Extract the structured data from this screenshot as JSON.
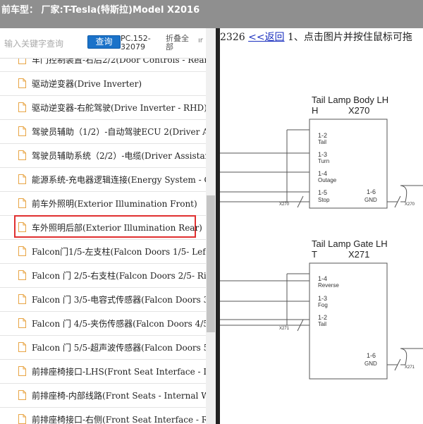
{
  "header": {
    "title": "前车型：  厂家:T-Tesla(特斯拉)Model X2016"
  },
  "search": {
    "placeholder": "输入关键字查询",
    "button": "查询",
    "code": "PC.152-32079",
    "collapse": "折叠全部",
    "extra": "ır"
  },
  "tree": {
    "items": [
      {
        "label": "车门控制装置-右后2/2(Door Controls - Rear R"
      },
      {
        "label": "驱动逆变器(Drive Inverter)"
      },
      {
        "label": "驱动逆变器-右舵驾驶(Drive Inverter - RHD)"
      },
      {
        "label": "驾驶员辅助（1/2）-自动驾驶ECU 2(Driver A"
      },
      {
        "label": "驾驶员辅助系统（2/2）-电缆(Driver Assistar"
      },
      {
        "label": "能源系统-充电器逻辑连接(Energy System - C"
      },
      {
        "label": "前车外照明(Exterior Illumination Front)"
      },
      {
        "label": "车外照明后部(Exterior Illumination Rear)"
      },
      {
        "label": "Falcon门1/5-左支柱(Falcon Doors 1/5- Left S"
      },
      {
        "label": "Falcon 门 2/5-右支柱(Falcon Doors 2/5- Righ"
      },
      {
        "label": "Falcon 门 3/5-电容式传感器(Falcon Doors 3/"
      },
      {
        "label": "Falcon 门 4/5-夹伤传感器(Falcon Doors 4/5-"
      },
      {
        "label": "Falcon 门 5/5-超声波传感器(Falcon Doors 5/"
      },
      {
        "label": "前排座椅接口-LHS(Front Seat Interface - LHS"
      },
      {
        "label": "前排座椅-内部线路(Front Seats - Internal Wir"
      },
      {
        "label": "前排座椅接口-右侧(Front Seat Interface - RH"
      }
    ],
    "highlighted_index": 7
  },
  "nav": {
    "page": "2326 ",
    "back": "<<返回",
    "hint": " 1、点击图片并按住鼠标可拖"
  },
  "diagram": {
    "box1": {
      "title": "Tail Lamp Body LH",
      "code_letter": "H",
      "code": "X270",
      "pins": [
        {
          "num": "1-2",
          "name": "Tail"
        },
        {
          "num": "1-3",
          "name": "Turn"
        },
        {
          "num": "1-4",
          "name": "Outage"
        },
        {
          "num": "1-5",
          "name": "Stop"
        }
      ],
      "gnd_num": "1-6",
      "gnd_name": "GND",
      "conn_left": "X270",
      "conn_right": "X270"
    },
    "box2": {
      "title": "Tail Lamp Gate LH",
      "code_letter": "T",
      "code": "X271",
      "pins": [
        {
          "num": "1-4",
          "name": "Reverse"
        },
        {
          "num": "1-3",
          "name": "Fog"
        },
        {
          "num": "1-2",
          "name": "Tail"
        }
      ],
      "gnd_num": "1-6",
      "gnd_name": "GND",
      "conn_left": "X271",
      "conn_right": "X271"
    }
  },
  "colors": {
    "titlebar": "#8f8f8f",
    "button": "#1a72c9",
    "highlight": "#e03030",
    "link": "#1a2fbf"
  }
}
